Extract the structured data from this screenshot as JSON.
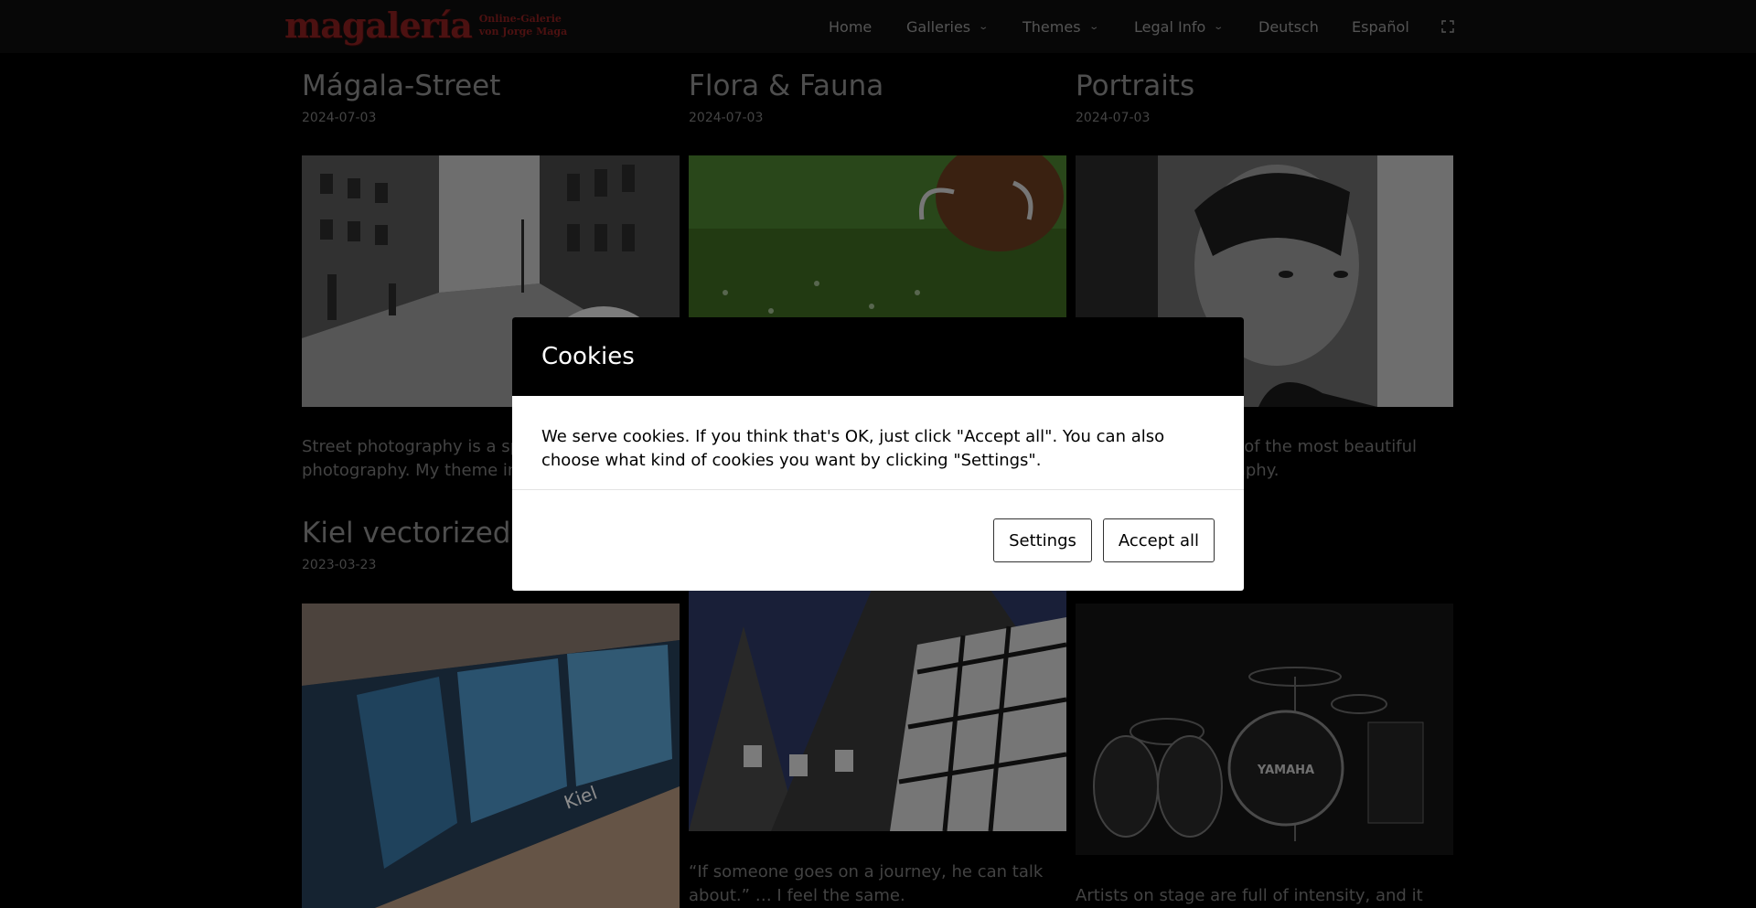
{
  "header": {
    "logo_text": "magalería",
    "logo_subtitle_1": "Online-Galerie",
    "logo_subtitle_2": "von Jorge Maga",
    "nav": [
      {
        "label": "Home"
      },
      {
        "label": "Galleries"
      },
      {
        "label": "Themes"
      },
      {
        "label": "Legal Info"
      },
      {
        "label": "Deutsch"
      },
      {
        "label": "Español"
      }
    ],
    "fullscreen_icon": "fullscreen-icon"
  },
  "posts": [
    {
      "title": "Mágala-Street",
      "date": "2024-07-03",
      "excerpt": "Street photography is a spe… photography. My theme in"
    },
    {
      "title": "Flora & Fauna",
      "date": "2024-07-03",
      "excerpt": ""
    },
    {
      "title": "Portraits",
      "date": "2024-07-03",
      "excerpt": "…ne of the most beautiful …graphy."
    },
    {
      "title": "Kiel vectorized",
      "date": "2023-03-23",
      "excerpt": ""
    },
    {
      "title": "",
      "date": "",
      "excerpt": "“If someone goes on a journey, he can talk about.” … I feel the same."
    },
    {
      "title": "",
      "date": "",
      "excerpt": "Artists on stage are full of intensity, and it"
    }
  ],
  "excerpt_lines": {
    "p0_l1": "Street photography is a spe",
    "p0_l2": "photography. My theme in",
    "p2_l1": "ne of the most beautiful",
    "p2_l2": "graphy.",
    "p4_l1": "“If someone goes on a journey, he can talk",
    "p4_l2": "about.” … I feel the same.",
    "p5_l1": "Artists on stage are full of intensity, and it"
  },
  "image_text": {
    "drums_brand": "YAMAHA",
    "kiel_sign": "Kiel"
  },
  "modal": {
    "title": "Cookies",
    "body": "We serve cookies. If you think that's OK, just click \"Accept all\". You can also choose what kind of cookies you want by clicking \"Settings\".",
    "settings_label": "Settings",
    "accept_label": "Accept all"
  },
  "colors": {
    "background": "#000000",
    "header": "#0d0d0d",
    "logo": "#8a1f1f",
    "modal_head": "#000000",
    "modal_body": "#ffffff"
  }
}
